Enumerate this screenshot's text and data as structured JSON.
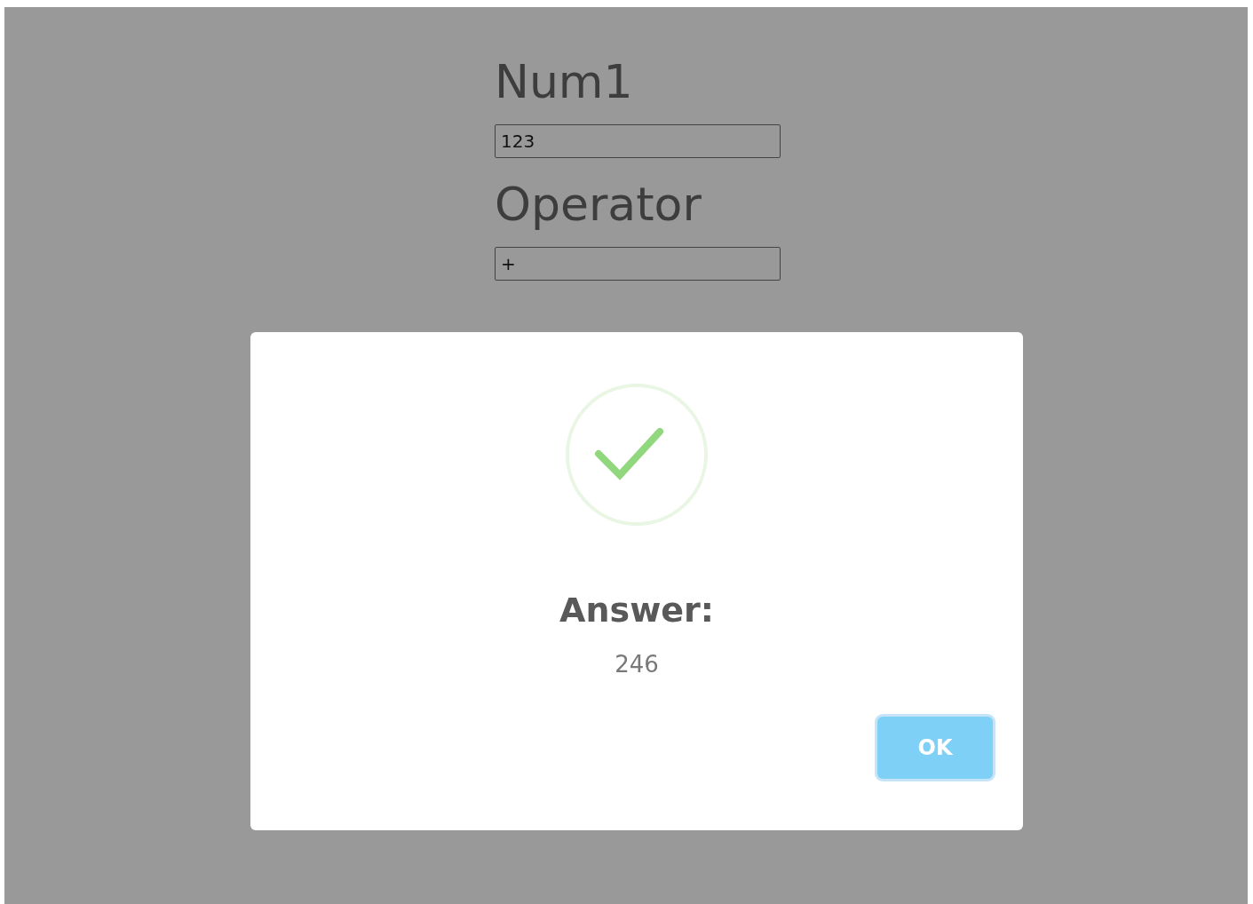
{
  "form": {
    "fields": [
      {
        "label": "Num1",
        "value": "123"
      },
      {
        "label": "Operator",
        "value": "+"
      }
    ]
  },
  "dialog": {
    "title": "Answer:",
    "message": "246",
    "buttons": [
      {
        "label": "OK",
        "focused": true
      }
    ]
  }
}
